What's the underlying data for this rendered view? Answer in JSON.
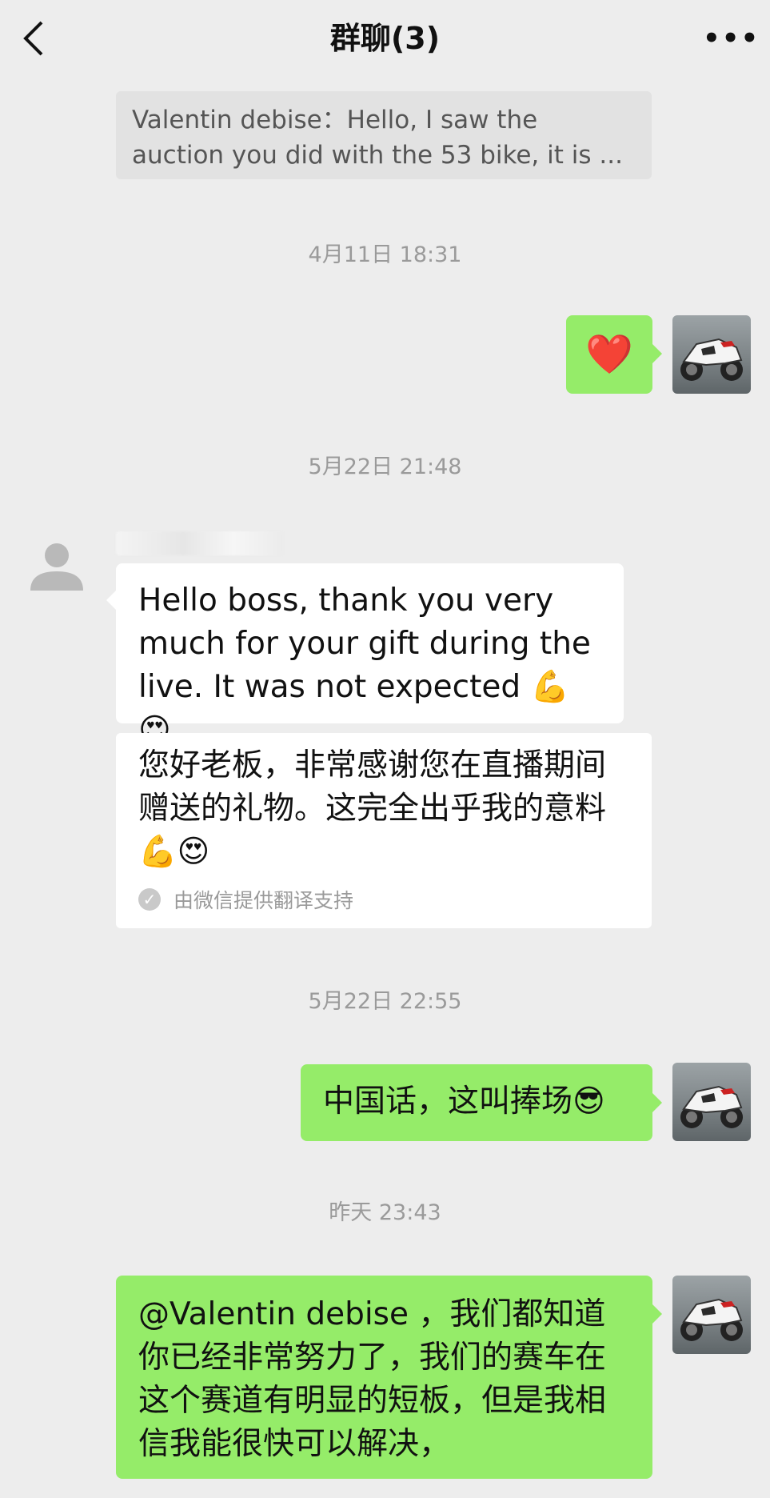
{
  "header": {
    "title": "群聊(3)",
    "more_label": "•••"
  },
  "quote": {
    "text": "Valentin debise：Hello, I saw the auction you did with the 53 bike, it is ..."
  },
  "timestamps": {
    "t1": "4月11日 18:31",
    "t2": "5月22日 21:48",
    "t3": "5月22日 22:55",
    "t4": "昨天 23:43"
  },
  "messages": {
    "m1": {
      "emoji": "❤️"
    },
    "m2": {
      "text": "Hello boss, thank you very much for your gift during the live. It was not expected 💪😍"
    },
    "m2_translation": {
      "text": "您好老板，非常感谢您在直播期间赠送的礼物。这完全出乎我的意料💪😍",
      "note": "由微信提供翻译支持"
    },
    "m3": {
      "text": "中国话，这叫捧场😎"
    },
    "m4": {
      "text": "@Valentin debise ，我们都知道你已经非常努力了，我们的赛车在这个赛道有明显的短板，但是我相信我能很快可以解决，"
    }
  },
  "colors": {
    "background": "#ededed",
    "bubble_green": "#95ec69",
    "bubble_white": "#ffffff",
    "timestamp_gray": "#9a9a9a"
  },
  "icons": {
    "back": "chevron-left-icon",
    "more": "more-dots-icon",
    "check": "check-circle-icon"
  }
}
